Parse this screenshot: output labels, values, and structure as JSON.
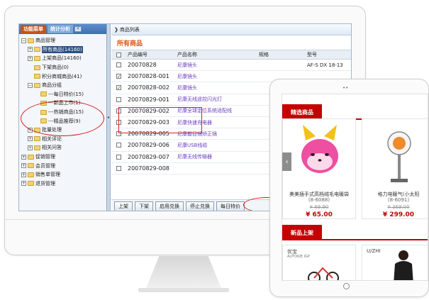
{
  "monitor": {
    "left_tabs": [
      {
        "label": "功能菜单",
        "active": true
      },
      {
        "label": "统计分析",
        "active": false
      }
    ],
    "tree": [
      {
        "indent": 0,
        "exp": "-",
        "label": "商品管理"
      },
      {
        "indent": 1,
        "exp": "+",
        "label": "所有商品(14160)",
        "selected": true
      },
      {
        "indent": 1,
        "exp": "+",
        "label": "上架商品(14160)"
      },
      {
        "indent": 1,
        "exp": "",
        "label": "下架商品(0)"
      },
      {
        "indent": 1,
        "exp": "",
        "label": "积分商城商品(41)"
      },
      {
        "indent": 1,
        "exp": "-",
        "label": "商品分组"
      },
      {
        "indent": 2,
        "exp": "",
        "label": "---每日特价(15)"
      },
      {
        "indent": 2,
        "exp": "",
        "label": "---新品上市(1)"
      },
      {
        "indent": 2,
        "exp": "",
        "label": "---热销商品(15)"
      },
      {
        "indent": 2,
        "exp": "",
        "label": "---精品推荐(9)"
      },
      {
        "indent": 1,
        "exp": "+",
        "label": "批量处理"
      },
      {
        "indent": 1,
        "exp": "+",
        "label": "相关评论"
      },
      {
        "indent": 1,
        "exp": "+",
        "label": "相关问答"
      },
      {
        "indent": 0,
        "exp": "+",
        "label": "促销管理"
      },
      {
        "indent": 0,
        "exp": "+",
        "label": "会员管理"
      },
      {
        "indent": 0,
        "exp": "+",
        "label": "销售单管理"
      },
      {
        "indent": 0,
        "exp": "+",
        "label": "退货管理"
      }
    ],
    "right_header": "商品列表",
    "section_title": "所有商品",
    "columns": [
      "产品编号",
      "产品名称",
      "规格",
      "型号"
    ],
    "rows": [
      {
        "code": "20070828",
        "name": "尼康镜头",
        "spec": "",
        "model": "AF-S DX 18-13",
        "checked": false
      },
      {
        "code": "20070828-001",
        "name": "尼康镜头",
        "spec": "",
        "model": "",
        "checked": true
      },
      {
        "code": "20070828-002",
        "name": "尼康镜头",
        "spec": "",
        "model": "",
        "checked": true
      },
      {
        "code": "20070829-001",
        "name": "尼康无线遥控闪光灯",
        "spec": "",
        "model": "",
        "checked": false
      },
      {
        "code": "20070829-002",
        "name": "尼康全球定位系统适配线",
        "spec": "",
        "model": "",
        "checked": false
      },
      {
        "code": "20070829-003",
        "name": "尼康快速充电器",
        "spec": "",
        "model": "",
        "checked": false
      },
      {
        "code": "20070829-005",
        "name": "尼康握目镜矫正镜",
        "spec": "",
        "model": "",
        "checked": false
      },
      {
        "code": "20070829-006",
        "name": "尼康USB线缆",
        "spec": "",
        "model": "",
        "checked": false
      },
      {
        "code": "20070829-007",
        "name": "尼康无线传输器",
        "spec": "",
        "model": "",
        "checked": false
      },
      {
        "code": "20070829-008",
        "name": "",
        "spec": "",
        "model": "",
        "checked": false
      }
    ],
    "buttons": [
      "上架",
      "下架",
      "启用兑换",
      "停止兑换",
      "每日特价"
    ]
  },
  "tablet": {
    "camera_dots": "••",
    "section1_title": "精选商品",
    "products": [
      {
        "name": "美美插手式高档绒毛电暖袋",
        "code": "(8-6088)",
        "old_price": "¥ 69.90",
        "price": "¥ 65.00"
      },
      {
        "name": "格力电暖气(小太阳",
        "code": "(8-6091)",
        "old_price": "¥ 369.00",
        "price": "¥ 299.00"
      }
    ],
    "section2_title": "新品上架",
    "new_items": [
      {
        "brand_left": "优宝",
        "brand_sub": "AUTOKIE IGP"
      },
      {
        "brand_left": "U/ZHI"
      }
    ],
    "nav_arrow": "‹"
  },
  "colors": {
    "accent_red": "#c40000",
    "highlight_red": "#d42020",
    "title_orange": "#d9530d",
    "product_purple": "#6c3fbf"
  }
}
